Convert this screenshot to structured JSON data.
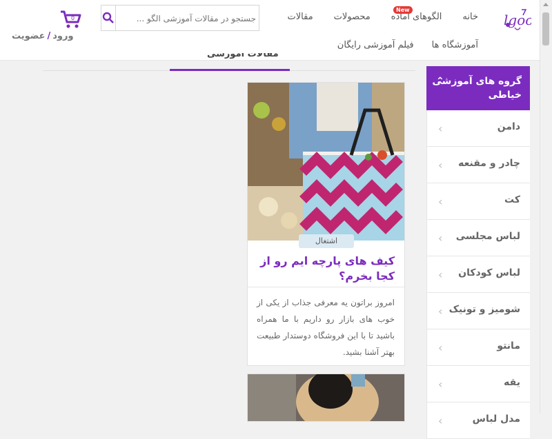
{
  "header": {
    "nav": [
      "خانه",
      "الگوهای آماده",
      "محصولات",
      "مقالات"
    ],
    "nav2": [
      "آموزشگاه ها",
      "فیلم آموزشی رایگان"
    ],
    "new_badge": "New",
    "search_placeholder": "جستجو در مقالات آموزشی الگو ...",
    "auth_login": "ورود",
    "auth_separator": "/",
    "auth_register": "عضویت",
    "accent_color": "#7b2cbf"
  },
  "tabs": {
    "active_label": "مقالات آموزشی"
  },
  "card": {
    "tag": "اشتغال",
    "title": "کیف های پارچه ایم رو از کجا بخرم؟",
    "description": "امروز براتون یه معرفی جذاب از یکی از خوب های بازار رو داریم با ما همراه باشید تا با این فروشگاه دوستدار طبیعت بهتر آشنا بشید."
  },
  "sidebar": {
    "title": "گروه های آموزشی خیاطی",
    "items": [
      "دامن",
      "چادر و مقنعه",
      "کت",
      "لباس مجلسی",
      "لباس کودکان",
      "شومیز و تونیک",
      "مانتو",
      "یقه",
      "مدل لباس"
    ]
  }
}
